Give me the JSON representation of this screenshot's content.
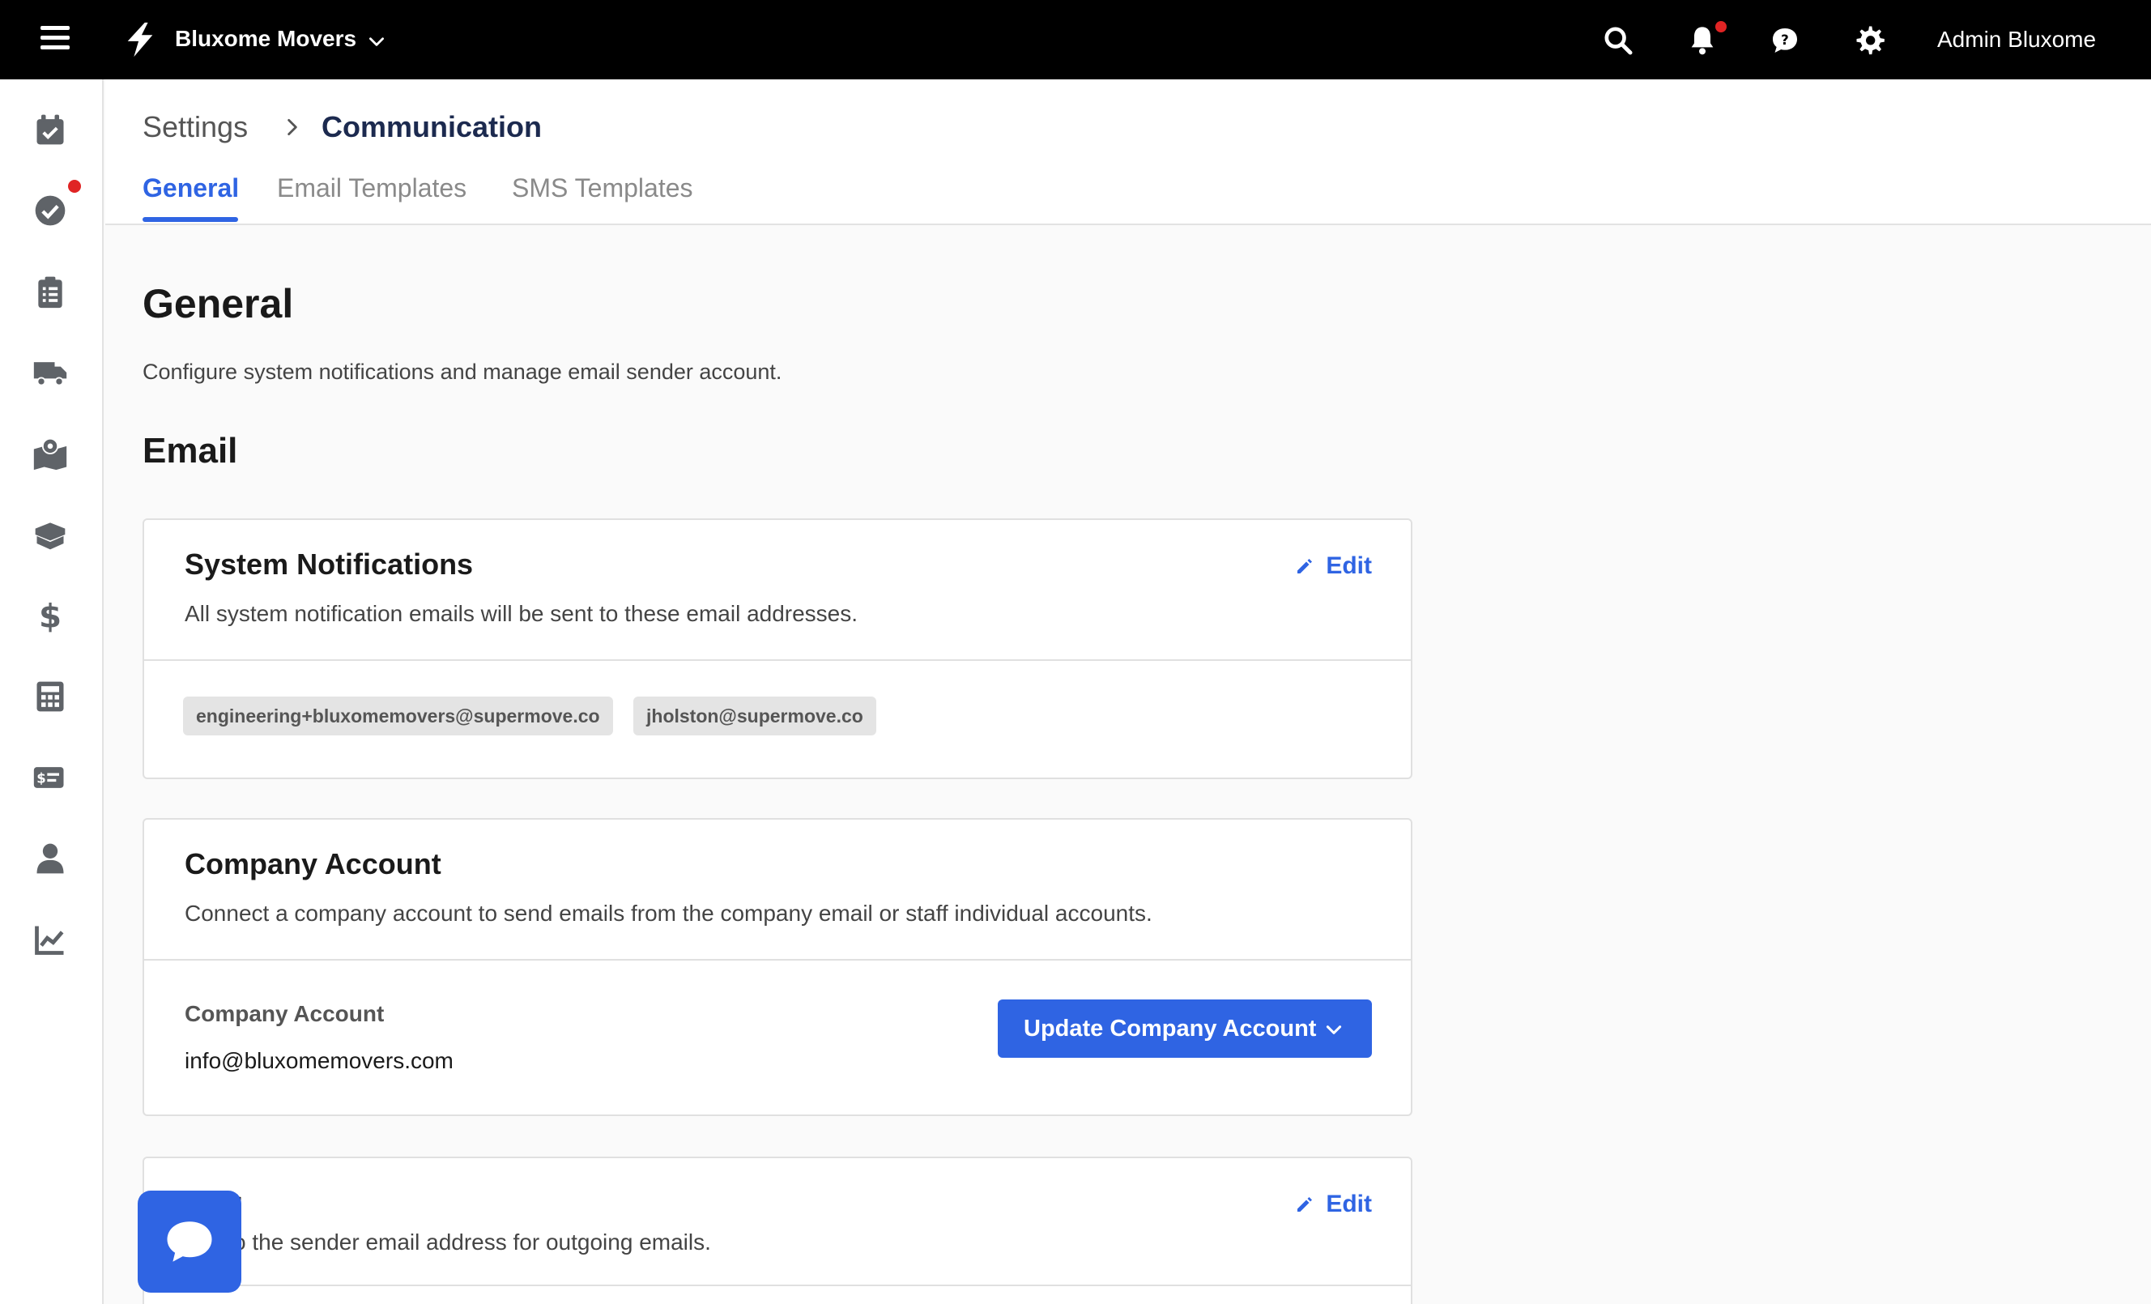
{
  "topbar": {
    "brand_name": "Bluxome Movers",
    "user_name": "Admin Bluxome",
    "icons": [
      "menu-icon",
      "logo-bolt-icon",
      "chevron-down-icon",
      "search-icon",
      "bell-icon",
      "chat-icon",
      "gear-icon"
    ]
  },
  "sidebar": {
    "items": [
      "calendar-check-icon",
      "check-circle-icon",
      "clipboard-list-icon",
      "truck-icon",
      "map-icon",
      "box-icon",
      "dollar-icon",
      "calculator-icon",
      "billing-icon",
      "user-icon",
      "chart-icon"
    ]
  },
  "breadcrumb": {
    "parent": "Settings",
    "current": "Communication"
  },
  "tabs": [
    {
      "label": "General",
      "active": true
    },
    {
      "label": "Email Templates",
      "active": false
    },
    {
      "label": "SMS Templates",
      "active": false
    }
  ],
  "main": {
    "title": "General",
    "description": "Configure system notifications and manage email sender account.",
    "section_title": "Email"
  },
  "system_notifications": {
    "title": "System Notifications",
    "description": "All system notification emails will be sent to these email addresses.",
    "edit_label": "Edit",
    "emails": [
      "engineering+bluxomemovers@supermove.co",
      "jholston@supermove.co"
    ]
  },
  "company_account": {
    "title": "Company Account",
    "description": "Connect a company account to send emails from the company email or staff individual accounts.",
    "field_label": "Company Account",
    "field_value": "info@bluxomemovers.com",
    "button_label": "Update Company Account"
  },
  "sender": {
    "title_partial": "der",
    "description_partial": "o the sender email address for outgoing emails.",
    "edit_label": "Edit"
  },
  "colors": {
    "accent": "#2f64e3",
    "topbar": "#000000",
    "notification_dot": "#e02424"
  }
}
